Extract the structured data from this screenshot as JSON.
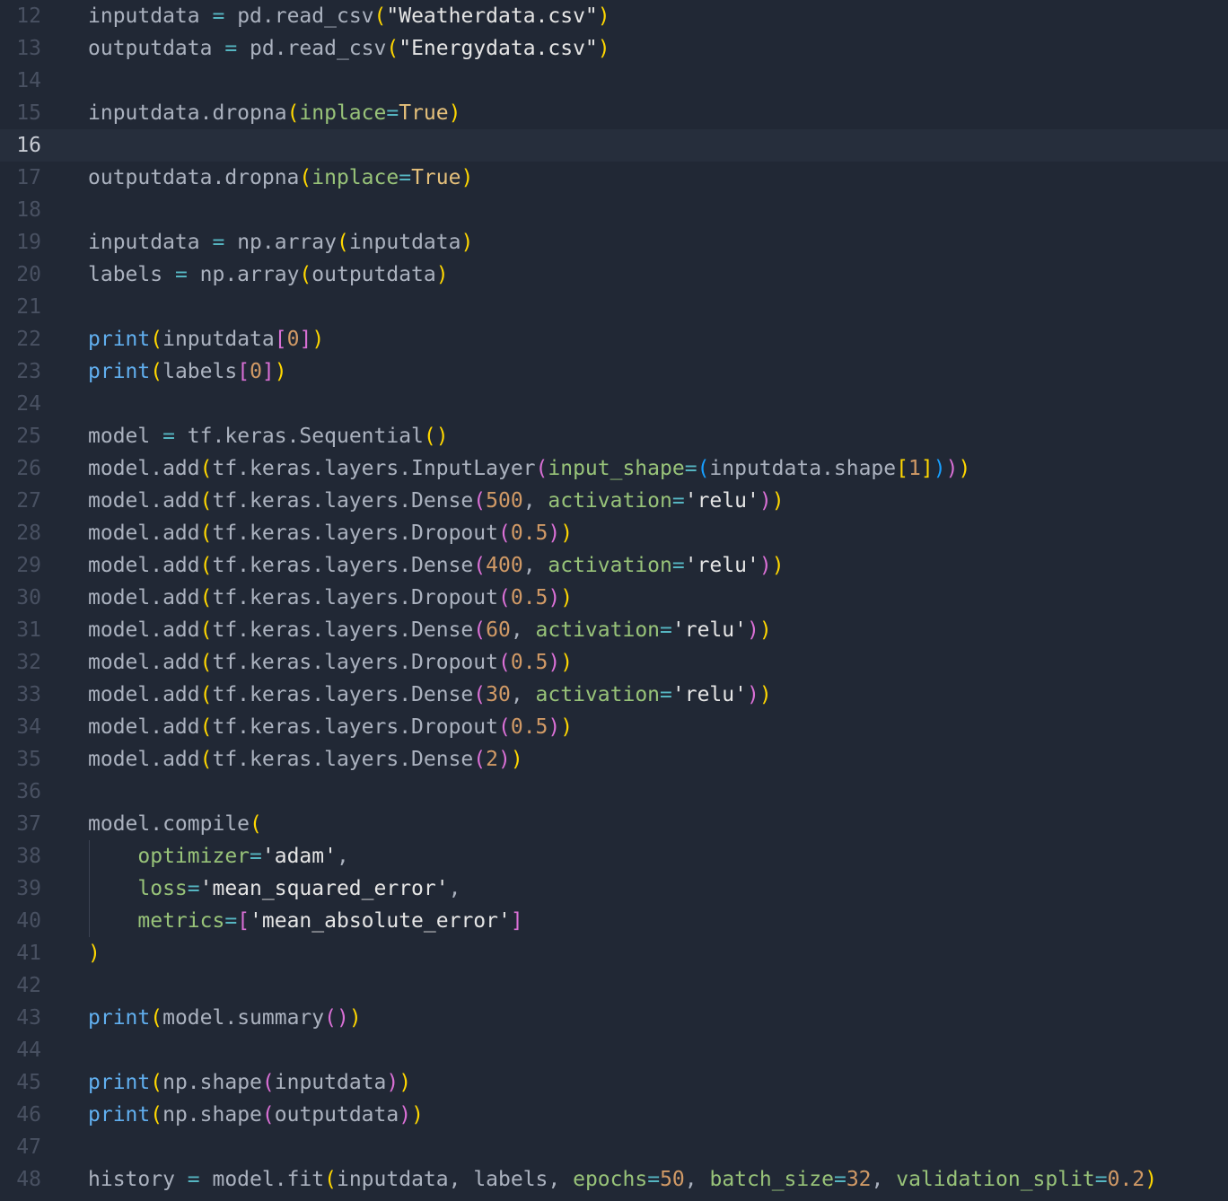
{
  "editor": {
    "current_line": 16,
    "colors": {
      "background": "#212835",
      "current_line_background": "#262e3c",
      "gutter": "#495162",
      "identifier": "#abb2bf",
      "operator": "#56b6c2",
      "string": "#e5e5e5",
      "keyword_constant": "#e5c07b",
      "builtin_function": "#61afef",
      "parameter": "#98c379",
      "number": "#d19a66",
      "bracket_level_1": "#ffd700",
      "bracket_level_2": "#da70d6",
      "bracket_level_3": "#179fff"
    },
    "lines": [
      {
        "n": "12",
        "tokens": [
          [
            "id",
            "inputdata "
          ],
          [
            "op",
            "="
          ],
          [
            "id",
            " pd.read_csv"
          ],
          [
            "b1",
            "("
          ],
          [
            "str",
            "\"Weatherdata.csv\""
          ],
          [
            "b1",
            ")"
          ]
        ]
      },
      {
        "n": "13",
        "tokens": [
          [
            "id",
            "outputdata "
          ],
          [
            "op",
            "="
          ],
          [
            "id",
            " pd.read_csv"
          ],
          [
            "b1",
            "("
          ],
          [
            "str",
            "\"Energydata.csv\""
          ],
          [
            "b1",
            ")"
          ]
        ]
      },
      {
        "n": "14",
        "tokens": []
      },
      {
        "n": "15",
        "tokens": [
          [
            "id",
            "inputdata.dropna"
          ],
          [
            "b1",
            "("
          ],
          [
            "par",
            "inplace"
          ],
          [
            "op",
            "="
          ],
          [
            "kw",
            "True"
          ],
          [
            "b1",
            ")"
          ]
        ]
      },
      {
        "n": "16",
        "tokens": []
      },
      {
        "n": "17",
        "tokens": [
          [
            "id",
            "outputdata.dropna"
          ],
          [
            "b1",
            "("
          ],
          [
            "par",
            "inplace"
          ],
          [
            "op",
            "="
          ],
          [
            "kw",
            "True"
          ],
          [
            "b1",
            ")"
          ]
        ]
      },
      {
        "n": "18",
        "tokens": []
      },
      {
        "n": "19",
        "tokens": [
          [
            "id",
            "inputdata "
          ],
          [
            "op",
            "="
          ],
          [
            "id",
            " np.array"
          ],
          [
            "b1",
            "("
          ],
          [
            "id",
            "inputdata"
          ],
          [
            "b1",
            ")"
          ]
        ]
      },
      {
        "n": "20",
        "tokens": [
          [
            "id",
            "labels "
          ],
          [
            "op",
            "="
          ],
          [
            "id",
            " np.array"
          ],
          [
            "b1",
            "("
          ],
          [
            "id",
            "outputdata"
          ],
          [
            "b1",
            ")"
          ]
        ]
      },
      {
        "n": "21",
        "tokens": []
      },
      {
        "n": "22",
        "tokens": [
          [
            "fn",
            "print"
          ],
          [
            "b1",
            "("
          ],
          [
            "id",
            "inputdata"
          ],
          [
            "b2",
            "["
          ],
          [
            "num",
            "0"
          ],
          [
            "b2",
            "]"
          ],
          [
            "b1",
            ")"
          ]
        ]
      },
      {
        "n": "23",
        "tokens": [
          [
            "fn",
            "print"
          ],
          [
            "b1",
            "("
          ],
          [
            "id",
            "labels"
          ],
          [
            "b2",
            "["
          ],
          [
            "num",
            "0"
          ],
          [
            "b2",
            "]"
          ],
          [
            "b1",
            ")"
          ]
        ]
      },
      {
        "n": "24",
        "tokens": []
      },
      {
        "n": "25",
        "tokens": [
          [
            "id",
            "model "
          ],
          [
            "op",
            "="
          ],
          [
            "id",
            " tf.keras.Sequential"
          ],
          [
            "b1",
            "()"
          ]
        ]
      },
      {
        "n": "26",
        "tokens": [
          [
            "id",
            "model.add"
          ],
          [
            "b1",
            "("
          ],
          [
            "id",
            "tf.keras.layers.InputLayer"
          ],
          [
            "b2",
            "("
          ],
          [
            "par",
            "input_shape"
          ],
          [
            "op",
            "="
          ],
          [
            "b3",
            "("
          ],
          [
            "id",
            "inputdata.shape"
          ],
          [
            "b1",
            "["
          ],
          [
            "num",
            "1"
          ],
          [
            "b1",
            "]"
          ],
          [
            "b3",
            ")"
          ],
          [
            "b2",
            ")"
          ],
          [
            "b1",
            ")"
          ]
        ]
      },
      {
        "n": "27",
        "tokens": [
          [
            "id",
            "model.add"
          ],
          [
            "b1",
            "("
          ],
          [
            "id",
            "tf.keras.layers.Dense"
          ],
          [
            "b2",
            "("
          ],
          [
            "num",
            "500"
          ],
          [
            "pu",
            ", "
          ],
          [
            "par",
            "activation"
          ],
          [
            "op",
            "="
          ],
          [
            "str",
            "'relu'"
          ],
          [
            "b2",
            ")"
          ],
          [
            "b1",
            ")"
          ]
        ]
      },
      {
        "n": "28",
        "tokens": [
          [
            "id",
            "model.add"
          ],
          [
            "b1",
            "("
          ],
          [
            "id",
            "tf.keras.layers.Dropout"
          ],
          [
            "b2",
            "("
          ],
          [
            "num",
            "0.5"
          ],
          [
            "b2",
            ")"
          ],
          [
            "b1",
            ")"
          ]
        ]
      },
      {
        "n": "29",
        "tokens": [
          [
            "id",
            "model.add"
          ],
          [
            "b1",
            "("
          ],
          [
            "id",
            "tf.keras.layers.Dense"
          ],
          [
            "b2",
            "("
          ],
          [
            "num",
            "400"
          ],
          [
            "pu",
            ", "
          ],
          [
            "par",
            "activation"
          ],
          [
            "op",
            "="
          ],
          [
            "str",
            "'relu'"
          ],
          [
            "b2",
            ")"
          ],
          [
            "b1",
            ")"
          ]
        ]
      },
      {
        "n": "30",
        "tokens": [
          [
            "id",
            "model.add"
          ],
          [
            "b1",
            "("
          ],
          [
            "id",
            "tf.keras.layers.Dropout"
          ],
          [
            "b2",
            "("
          ],
          [
            "num",
            "0.5"
          ],
          [
            "b2",
            ")"
          ],
          [
            "b1",
            ")"
          ]
        ]
      },
      {
        "n": "31",
        "tokens": [
          [
            "id",
            "model.add"
          ],
          [
            "b1",
            "("
          ],
          [
            "id",
            "tf.keras.layers.Dense"
          ],
          [
            "b2",
            "("
          ],
          [
            "num",
            "60"
          ],
          [
            "pu",
            ", "
          ],
          [
            "par",
            "activation"
          ],
          [
            "op",
            "="
          ],
          [
            "str",
            "'relu'"
          ],
          [
            "b2",
            ")"
          ],
          [
            "b1",
            ")"
          ]
        ]
      },
      {
        "n": "32",
        "tokens": [
          [
            "id",
            "model.add"
          ],
          [
            "b1",
            "("
          ],
          [
            "id",
            "tf.keras.layers.Dropout"
          ],
          [
            "b2",
            "("
          ],
          [
            "num",
            "0.5"
          ],
          [
            "b2",
            ")"
          ],
          [
            "b1",
            ")"
          ]
        ]
      },
      {
        "n": "33",
        "tokens": [
          [
            "id",
            "model.add"
          ],
          [
            "b1",
            "("
          ],
          [
            "id",
            "tf.keras.layers.Dense"
          ],
          [
            "b2",
            "("
          ],
          [
            "num",
            "30"
          ],
          [
            "pu",
            ", "
          ],
          [
            "par",
            "activation"
          ],
          [
            "op",
            "="
          ],
          [
            "str",
            "'relu'"
          ],
          [
            "b2",
            ")"
          ],
          [
            "b1",
            ")"
          ]
        ]
      },
      {
        "n": "34",
        "tokens": [
          [
            "id",
            "model.add"
          ],
          [
            "b1",
            "("
          ],
          [
            "id",
            "tf.keras.layers.Dropout"
          ],
          [
            "b2",
            "("
          ],
          [
            "num",
            "0.5"
          ],
          [
            "b2",
            ")"
          ],
          [
            "b1",
            ")"
          ]
        ]
      },
      {
        "n": "35",
        "tokens": [
          [
            "id",
            "model.add"
          ],
          [
            "b1",
            "("
          ],
          [
            "id",
            "tf.keras.layers.Dense"
          ],
          [
            "b2",
            "("
          ],
          [
            "num",
            "2"
          ],
          [
            "b2",
            ")"
          ],
          [
            "b1",
            ")"
          ]
        ]
      },
      {
        "n": "36",
        "tokens": []
      },
      {
        "n": "37",
        "tokens": [
          [
            "id",
            "model.compile"
          ],
          [
            "b1",
            "("
          ]
        ]
      },
      {
        "n": "38",
        "guide": true,
        "tokens": [
          [
            "pu",
            "    "
          ],
          [
            "par",
            "optimizer"
          ],
          [
            "op",
            "="
          ],
          [
            "str",
            "'adam'"
          ],
          [
            "pu",
            ","
          ]
        ]
      },
      {
        "n": "39",
        "guide": true,
        "tokens": [
          [
            "pu",
            "    "
          ],
          [
            "par",
            "loss"
          ],
          [
            "op",
            "="
          ],
          [
            "str",
            "'mean_squared_error'"
          ],
          [
            "pu",
            ","
          ]
        ]
      },
      {
        "n": "40",
        "guide": true,
        "tokens": [
          [
            "pu",
            "    "
          ],
          [
            "par",
            "metrics"
          ],
          [
            "op",
            "="
          ],
          [
            "b2",
            "["
          ],
          [
            "str",
            "'mean_absolute_error'"
          ],
          [
            "b2",
            "]"
          ]
        ]
      },
      {
        "n": "41",
        "tokens": [
          [
            "b1",
            ")"
          ]
        ]
      },
      {
        "n": "42",
        "tokens": []
      },
      {
        "n": "43",
        "tokens": [
          [
            "fn",
            "print"
          ],
          [
            "b1",
            "("
          ],
          [
            "id",
            "model.summary"
          ],
          [
            "b2",
            "()"
          ],
          [
            "b1",
            ")"
          ]
        ]
      },
      {
        "n": "44",
        "tokens": []
      },
      {
        "n": "45",
        "tokens": [
          [
            "fn",
            "print"
          ],
          [
            "b1",
            "("
          ],
          [
            "id",
            "np.shape"
          ],
          [
            "b2",
            "("
          ],
          [
            "id",
            "inputdata"
          ],
          [
            "b2",
            ")"
          ],
          [
            "b1",
            ")"
          ]
        ]
      },
      {
        "n": "46",
        "tokens": [
          [
            "fn",
            "print"
          ],
          [
            "b1",
            "("
          ],
          [
            "id",
            "np.shape"
          ],
          [
            "b2",
            "("
          ],
          [
            "id",
            "outputdata"
          ],
          [
            "b2",
            ")"
          ],
          [
            "b1",
            ")"
          ]
        ]
      },
      {
        "n": "47",
        "tokens": []
      },
      {
        "n": "48",
        "tokens": [
          [
            "id",
            "history "
          ],
          [
            "op",
            "="
          ],
          [
            "id",
            " model.fit"
          ],
          [
            "b1",
            "("
          ],
          [
            "id",
            "inputdata"
          ],
          [
            "pu",
            ", "
          ],
          [
            "id",
            "labels"
          ],
          [
            "pu",
            ", "
          ],
          [
            "par",
            "epochs"
          ],
          [
            "op",
            "="
          ],
          [
            "num",
            "50"
          ],
          [
            "pu",
            ", "
          ],
          [
            "par",
            "batch_size"
          ],
          [
            "op",
            "="
          ],
          [
            "num",
            "32"
          ],
          [
            "pu",
            ", "
          ],
          [
            "par",
            "validation_split"
          ],
          [
            "op",
            "="
          ],
          [
            "num",
            "0.2"
          ],
          [
            "b1",
            ")"
          ]
        ]
      }
    ]
  }
}
